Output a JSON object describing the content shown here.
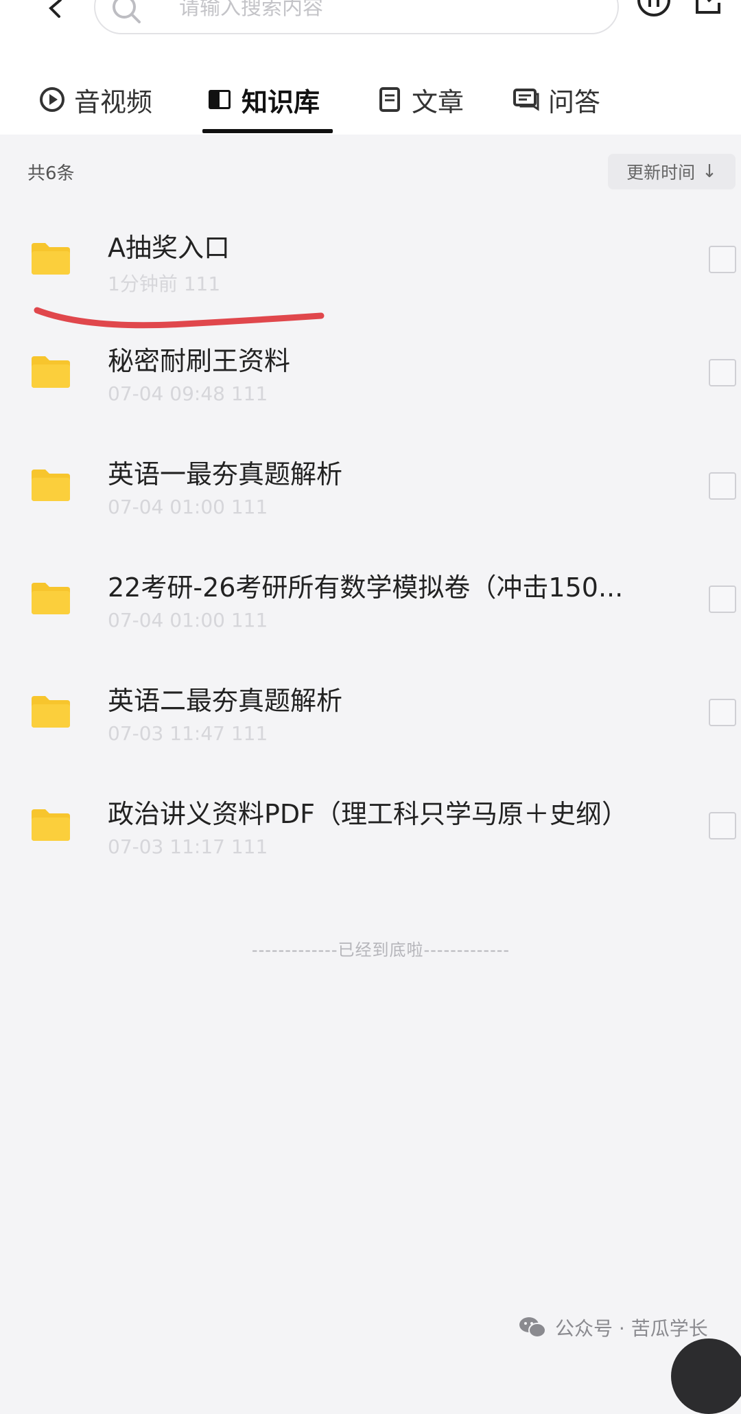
{
  "search": {
    "placeholder": "请输入搜索内容"
  },
  "icons": {
    "back": "chevron-left-icon",
    "search": "search-icon",
    "pause": "pause-icon",
    "share": "share-icon",
    "folder": "folder-icon",
    "wechat": "wechat-icon"
  },
  "colors": {
    "folder": "#f7c52d",
    "annotation": "#e0474c",
    "active_tab": "#111111"
  },
  "tabs": [
    {
      "label": "音视频",
      "icon": "play-circle-icon",
      "active": false
    },
    {
      "label": "知识库",
      "icon": "book-icon",
      "active": true
    },
    {
      "label": "文章",
      "icon": "document-icon",
      "active": false
    },
    {
      "label": "问答",
      "icon": "chat-icon",
      "active": false
    }
  ],
  "list_header": {
    "count": "共6条",
    "sort_label": "更新时间",
    "sort_arrow": "↓"
  },
  "items": [
    {
      "title": "A抽奖入口",
      "meta": "1分钟前 111"
    },
    {
      "title": "秘密耐刷王资料",
      "meta": "07-04 09:48 111"
    },
    {
      "title": "英语一最夯真题解析",
      "meta": "07-04 01:00 111"
    },
    {
      "title": "22考研-26考研所有数学模拟卷（冲击150...",
      "meta": "07-04 01:00 111"
    },
    {
      "title": "英语二最夯真题解析",
      "meta": "07-03 11:47 111"
    },
    {
      "title": "政治讲义资料PDF（理工科只学马原＋史纲）",
      "meta": "07-03 11:17 111"
    }
  ],
  "end_text": "-------------已经到底啦-------------",
  "watermark": "公众号 · 苦瓜学长"
}
